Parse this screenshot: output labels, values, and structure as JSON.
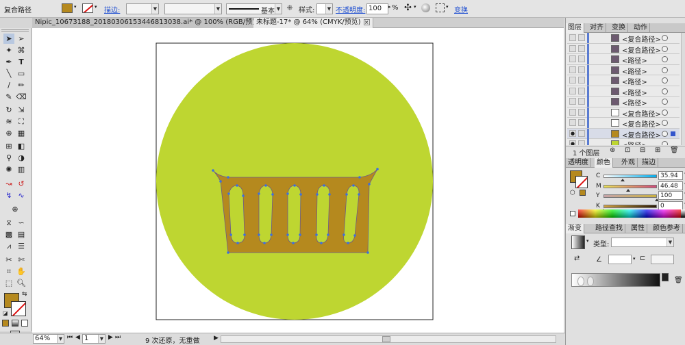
{
  "control_bar": {
    "object_type": "复合路径",
    "stroke_label": "描边:",
    "stroke_profile": "基本",
    "style_label": "样式:",
    "opacity_label": "不透明度:",
    "opacity_value": "100",
    "opacity_unit": "%",
    "transform_label": "变换",
    "fill_color": "#b5891e"
  },
  "doc_tabs": [
    {
      "label": "Nipic_10673188_20180306153446813038.ai* @ 100% (RGB/预览)"
    },
    {
      "label": "未标题-17* @ 64% (CMYK/预览)"
    }
  ],
  "tools": {
    "fill_color": "#b5891e"
  },
  "artwork": {
    "circle_color": "#bed631",
    "basket_color": "#b5891e",
    "anchor_color": "#3d6fe0",
    "slot_count": 5
  },
  "status_bar": {
    "zoom": "64%",
    "artboard": "1",
    "info": "9 次还原，无重做"
  },
  "layers_panel": {
    "tabs": [
      "图层",
      "对齐",
      "变换",
      "动作"
    ],
    "rows": [
      {
        "name": "<复合路径>",
        "thumb": "#6d5a70",
        "visible": false,
        "selected": false
      },
      {
        "name": "<复合路径>",
        "thumb": "#6d5a70",
        "visible": false,
        "selected": false
      },
      {
        "name": "<路径>",
        "thumb": "#6d5a70",
        "visible": false,
        "selected": false
      },
      {
        "name": "<路径>",
        "thumb": "#6d5a70",
        "visible": false,
        "selected": false
      },
      {
        "name": "<路径>",
        "thumb": "#6d5a70",
        "visible": false,
        "selected": false
      },
      {
        "name": "<路径>",
        "thumb": "#6d5a70",
        "visible": false,
        "selected": false
      },
      {
        "name": "<路径>",
        "thumb": "#6d5a70",
        "visible": false,
        "selected": false
      },
      {
        "name": "<复合路径>",
        "thumb": "#ffffff",
        "visible": false,
        "selected": false
      },
      {
        "name": "<复合路径>",
        "thumb": "#ffffff",
        "visible": false,
        "selected": false
      },
      {
        "name": "<复合路径>",
        "thumb": "#b5891e",
        "visible": true,
        "selected": true
      },
      {
        "name": "<路径>",
        "thumb": "#bed631",
        "visible": true,
        "selected": false
      }
    ],
    "footer_count": "1 个图层"
  },
  "color_panel": {
    "tabs": [
      "透明度",
      "颜色",
      "外观",
      "描边"
    ],
    "channels": [
      {
        "ch": "C",
        "value": "35.94",
        "frac": 0.36,
        "grad": "linear-gradient(to right,#ffffff,#00aeef)"
      },
      {
        "ch": "M",
        "value": "46.48",
        "frac": 0.46,
        "grad": "linear-gradient(to right,#e8e05a,#d04a7a)"
      },
      {
        "ch": "Y",
        "value": "100",
        "frac": 1.0,
        "grad": "linear-gradient(to right,#c5a3a8,#c9b040)"
      },
      {
        "ch": "K",
        "value": "0",
        "frac": 0.0,
        "grad": "linear-gradient(to right,#d0a040,#2a1a05)"
      }
    ],
    "unit": "%"
  },
  "gradient_panel": {
    "tabs": [
      "渐变",
      "路径查找",
      "属性",
      "颜色参考"
    ],
    "type_label": "类型:"
  }
}
